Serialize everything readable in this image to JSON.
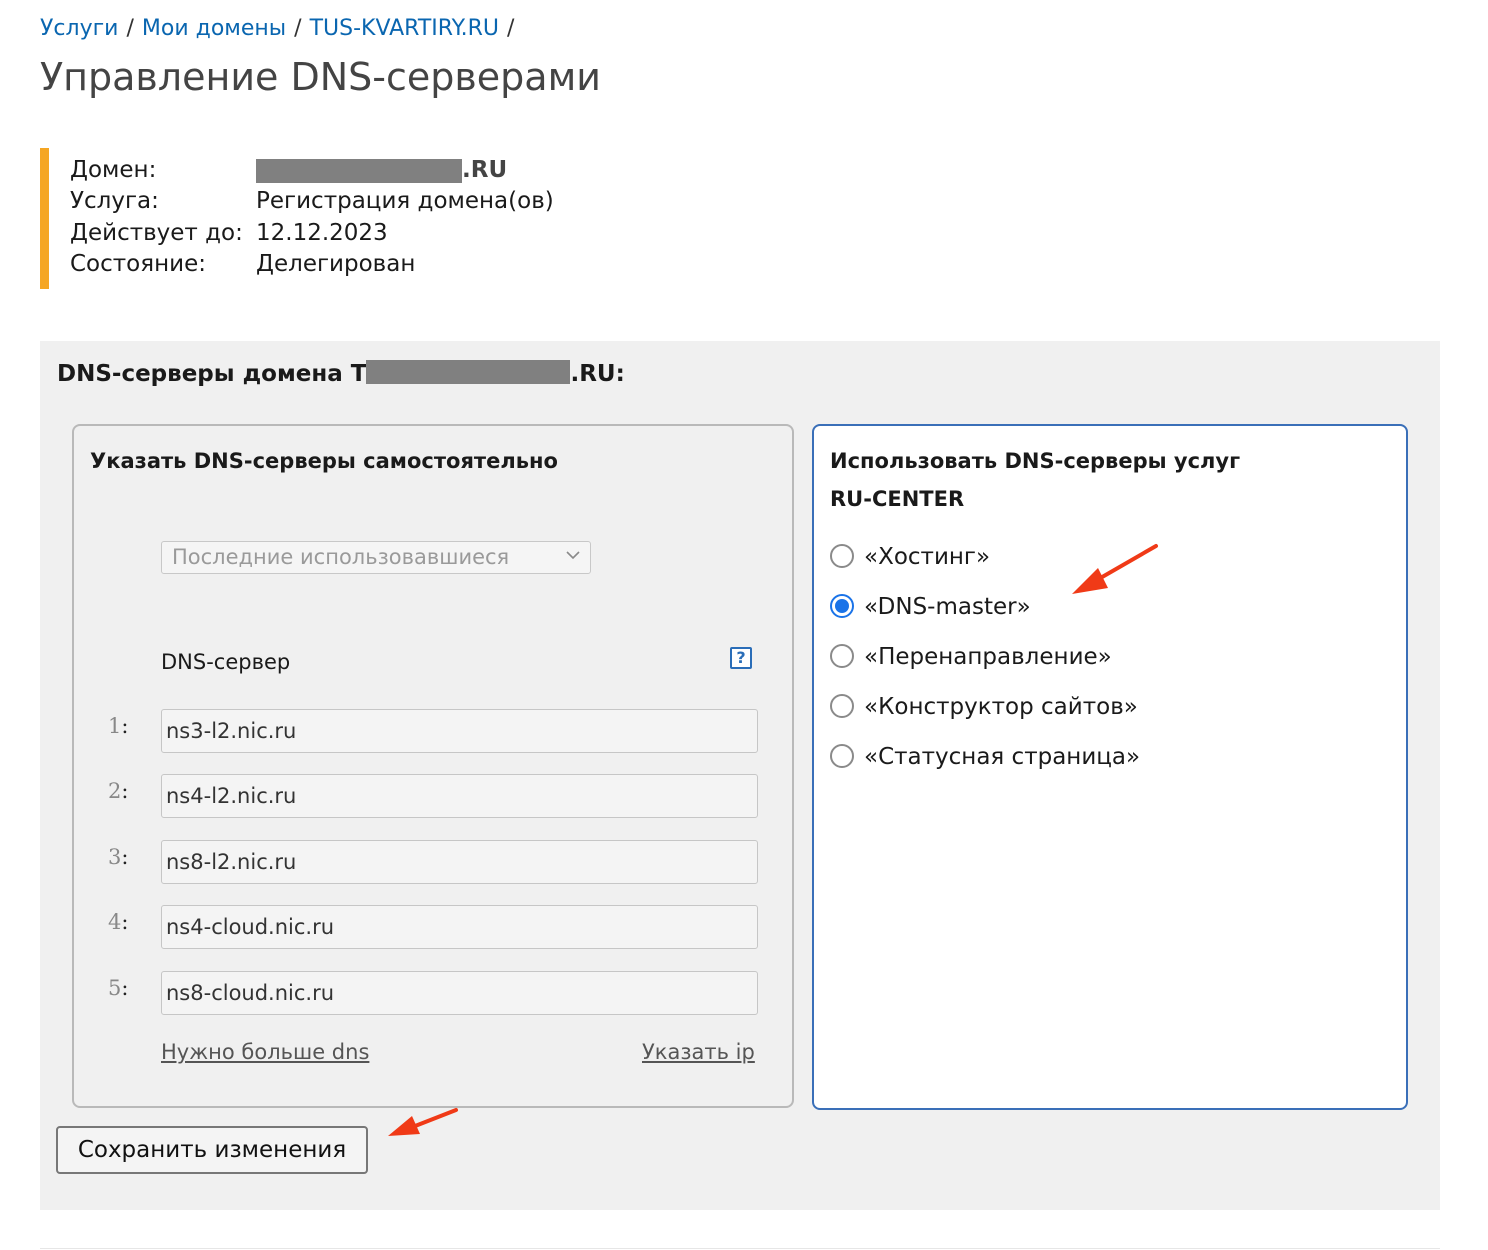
{
  "breadcrumb": {
    "items": [
      "Услуги",
      "Мои домены",
      "TUS-KVARTIRY.RU"
    ],
    "separator": "/"
  },
  "page_title": "Управление DNS-серверами",
  "info": {
    "domain_label": "Домен:",
    "domain_suffix": ".RU",
    "service_label": "Услуга:",
    "service_value": "Регистрация домена(ов)",
    "valid_label": "Действует до:",
    "valid_value": "12.12.2023",
    "state_label": "Состояние:",
    "state_value": "Делегирован",
    "accent_color": "#f5a623"
  },
  "dns_panel": {
    "title_prefix": "DNS-серверы домена T",
    "title_suffix": ".RU:"
  },
  "manual": {
    "title": "Указать DNS-серверы самостоятельно",
    "select_value": "Последние использовавшиеся",
    "dns_label": "DNS-сервер",
    "help_icon": "?",
    "servers": [
      {
        "num": "1",
        "value": "ns3-l2.nic.ru"
      },
      {
        "num": "2",
        "value": "ns4-l2.nic.ru"
      },
      {
        "num": "3",
        "value": "ns8-l2.nic.ru"
      },
      {
        "num": "4",
        "value": "ns4-cloud.nic.ru"
      },
      {
        "num": "5",
        "value": "ns8-cloud.nic.ru"
      }
    ],
    "more_dns_link": "Нужно больше dns",
    "specify_ip_link": "Указать ip"
  },
  "rucenter": {
    "title_line1": "Использовать DNS-серверы услуг",
    "title_line2": "RU-CENTER",
    "options": [
      {
        "label": "«Хостинг»",
        "selected": false
      },
      {
        "label": "«DNS-master»",
        "selected": true
      },
      {
        "label": "«Перенаправление»",
        "selected": false
      },
      {
        "label": "«Конструктор сайтов»",
        "selected": false
      },
      {
        "label": "«Статусная страница»",
        "selected": false
      }
    ],
    "selected_color": "#1a73e8"
  },
  "save_button": "Сохранить изменения",
  "annotation_arrow_color": "#f03a17"
}
